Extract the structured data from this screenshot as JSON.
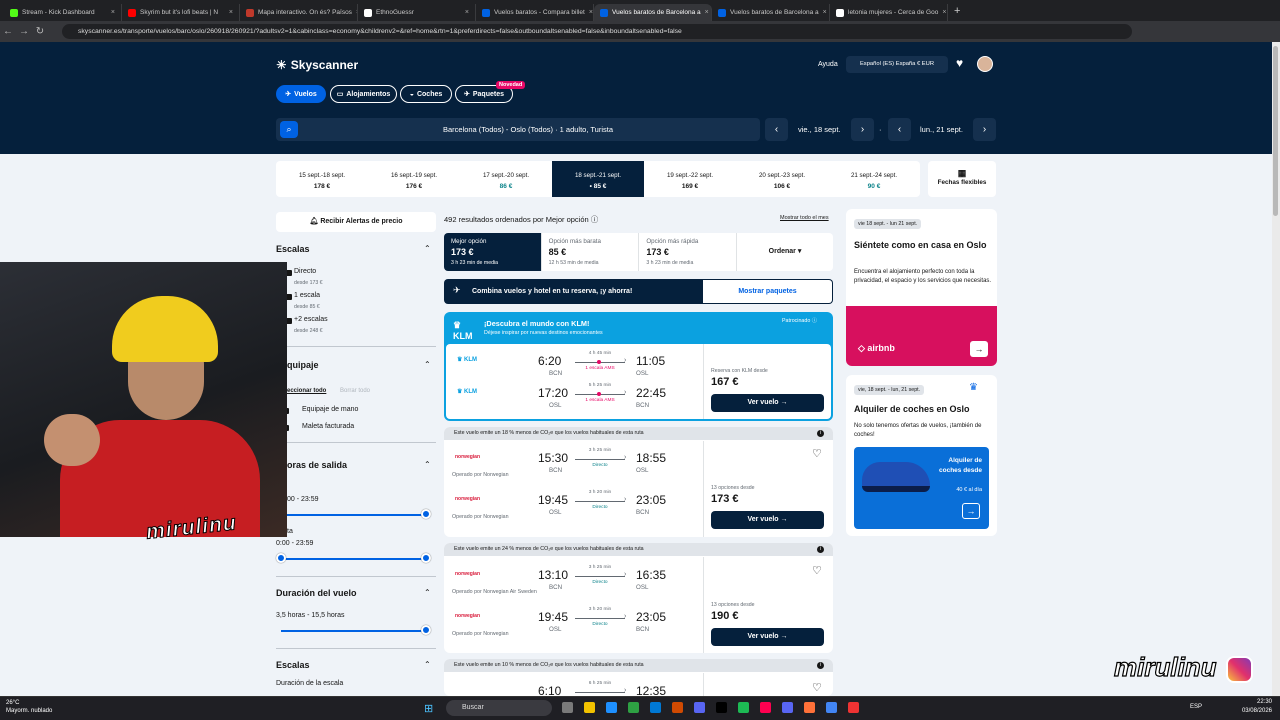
{
  "browser": {
    "tabs": [
      {
        "title": "Stream - Kick Dashboard",
        "color": "#53fc18"
      },
      {
        "title": "Skyrim but it's lofi beats | N",
        "color": "#ff0000"
      },
      {
        "title": "Mapa interactivo. On és? Països",
        "color": "#c0392b"
      },
      {
        "title": "EthnoGuessr",
        "color": "#ffffff"
      },
      {
        "title": "Vuelos baratos - Compara billet",
        "color": "#0062e3"
      },
      {
        "title": "Vuelos baratos de Barcelona a",
        "color": "#0062e3"
      },
      {
        "title": "Vuelos baratos de Barcelona a",
        "color": "#0062e3"
      },
      {
        "title": "letonia mujeres - Cerca de Goo",
        "color": "#ffffff"
      }
    ],
    "active_tab": 5,
    "url": "skyscanner.es/transporte/vuelos/barc/oslo/260918/260921/?adultsv2=1&cabinclass=economy&childrenv2=&ref=home&rtn=1&preferdirects=false&outboundaltsenabled=false&inboundaltsenabled=false"
  },
  "header": {
    "logo": "Skyscanner",
    "help": "Ayuda",
    "locale": "Español (ES)  España  € EUR",
    "nav": [
      "Vuelos",
      "Alojamientos",
      "Coches",
      "Paquetes"
    ],
    "new_badge": "Novedad",
    "search": "Barcelona (Todos) - Oslo (Todos)  ·  1 adulto, Turista",
    "depart": "vie., 18 sept.",
    "return": "lun., 21 sept."
  },
  "date_strip": [
    {
      "range": "15 sept.-18 sept.",
      "price": "178 €"
    },
    {
      "range": "16 sept.-19 sept.",
      "price": "176 €"
    },
    {
      "range": "17 sept.-20 sept.",
      "price": "86 €"
    },
    {
      "range": "18 sept.-21 sept.",
      "price": "• 85 €"
    },
    {
      "range": "19 sept.-22 sept.",
      "price": "169 €"
    },
    {
      "range": "20 sept.-23 sept.",
      "price": "106 €"
    },
    {
      "range": "21 sept.-24 sept.",
      "price": "90 €"
    }
  ],
  "flexible": "Fechas flexibles",
  "filters": {
    "alert": "Recibir Alertas de precio",
    "stops_title": "Escalas",
    "stops": [
      {
        "label": "Directo",
        "sub": "desde 173 €"
      },
      {
        "label": "1 escala",
        "sub": "desde 85 €"
      },
      {
        "label": "+2 escalas",
        "sub": "desde 248 €"
      }
    ],
    "luggage_title": "quipaje",
    "select_all": "eccionar todo",
    "clear_all": "Borrar todo",
    "luggage": [
      "Equipaje de mano",
      "Maleta facturada"
    ],
    "times_title": "oras de salida",
    "range1": "00 - 23:59",
    "ta": "ta",
    "range2": "0:00 - 23:59",
    "duration_title": "Duración del vuelo",
    "duration_range": "3,5 horas - 15,5 horas",
    "stops2_title": "Escalas",
    "layover": "Duración de la escala"
  },
  "results": {
    "count": "492 resultados ordenados por Mejor opción",
    "show_month": "Mostrar todo el mes",
    "sort": [
      {
        "label": "Mejor opción",
        "price": "173 €",
        "time": "3 h 23 min de media"
      },
      {
        "label": "Opción más barata",
        "price": "85 €",
        "time": "12 h 53 min de media"
      },
      {
        "label": "Opción más rápida",
        "price": "173 €",
        "time": "3 h 23 min de media"
      }
    ],
    "order": "Ordenar",
    "combo": "Combina vuelos y hotel en tu reserva, ¡y ahorra!",
    "combo_btn": "Mostrar paquetes"
  },
  "klm": {
    "brand": "KLM",
    "title": "¡Descubra el mundo con KLM!",
    "sub": "Déjese inspirar por nuevas destinos emocionantes",
    "sponsored": "Patrocinado",
    "legs": [
      {
        "dep": "6:20",
        "depap": "BCN",
        "arr": "11:05",
        "arrap": "OSL",
        "dur": "4 h 45 min",
        "stop": "1 escala AMS"
      },
      {
        "dep": "17:20",
        "depap": "OSL",
        "arr": "22:45",
        "arrap": "BCN",
        "dur": "5 h 25 min",
        "stop": "1 escala AMS"
      }
    ],
    "price_label": "Reserva con KLM desde",
    "price": "167 €",
    "btn": "Ver vuelo"
  },
  "cards": [
    {
      "eco": "Este vuelo emite un 18 % menos de CO₂e que los vuelos habituales de esta ruta",
      "legs": [
        {
          "dep": "15:30",
          "depap": "BCN",
          "arr": "18:55",
          "arrap": "OSL",
          "dur": "3 h 25 min",
          "stop": "Directo",
          "airline": "norwegian",
          "op": "Operado por Norwegian"
        },
        {
          "dep": "19:45",
          "depap": "OSL",
          "arr": "23:05",
          "arrap": "BCN",
          "dur": "3 h 20 min",
          "stop": "Directo",
          "airline": "norwegian",
          "op": "Operado por Norwegian"
        }
      ],
      "options": "13 opciones desde",
      "price": "173 €",
      "btn": "Ver vuelo"
    },
    {
      "eco": "Este vuelo emite un 24 % menos de CO₂e que los vuelos habituales de esta ruta",
      "legs": [
        {
          "dep": "13:10",
          "depap": "BCN",
          "arr": "16:35",
          "arrap": "OSL",
          "dur": "3 h 25 min",
          "stop": "Directo",
          "airline": "norwegian",
          "op": "Operado por Norwegian Air Sweden"
        },
        {
          "dep": "19:45",
          "depap": "OSL",
          "arr": "23:05",
          "arrap": "BCN",
          "dur": "3 h 20 min",
          "stop": "Directo",
          "airline": "norwegian",
          "op": "Operado por Norwegian"
        }
      ],
      "options": "13 opciones desde",
      "price": "190 €",
      "btn": "Ver vuelo"
    },
    {
      "eco": "Este vuelo emite un 10 % menos de CO₂e que los vuelos habituales de esta ruta",
      "legs": [
        {
          "dep": "6:10",
          "dur": "6 h 25 min",
          "arr": "12:35"
        }
      ]
    }
  ],
  "right": {
    "hotel_tag": "vie 18 sept. - lun 21 sept.",
    "hotel_title": "Siéntete como en casa en Oslo",
    "hotel_text": "Encuentra el alojamiento perfecto con toda la privacidad, el espacio y los servicios que necesitas.",
    "hotel_brand": "airbnb",
    "car_tag": "vie, 18 sept. - lun, 21 sept.",
    "car_title": "Alquiler de coches en Oslo",
    "car_text": "No solo tenemos ofertas de vuelos, ¡también de coches!",
    "car_ad": "Alquiler de coches desde",
    "car_ad_price": "40 € al día"
  },
  "overlay": {
    "cam_text": "mirulinu",
    "brand": "mirulinu"
  },
  "taskbar": {
    "temp": "26°C",
    "weather": "Mayorm. nublado",
    "search": "Buscar",
    "lang": "ESP",
    "time": "22:30",
    "date": "03/08/2026"
  }
}
